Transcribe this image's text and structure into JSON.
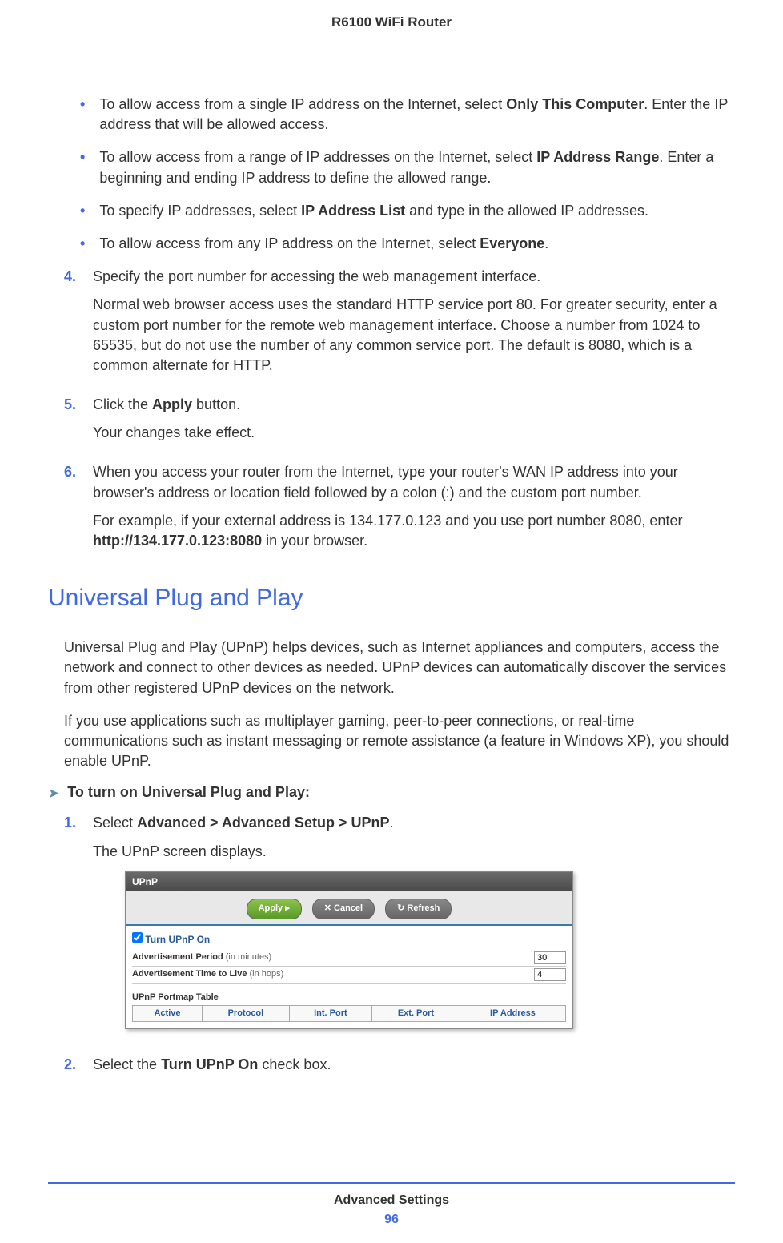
{
  "header_title": "R6100 WiFi Router",
  "sub_bullets": [
    {
      "pre": "To allow access from a single IP address on the Internet, select ",
      "bold": "Only This Computer",
      "post": ". Enter the IP address that will be allowed access."
    },
    {
      "pre": " To allow access from a range of IP addresses on the Internet, select ",
      "bold": "IP Address Range",
      "post": ". Enter a beginning and ending IP address to define the allowed range."
    },
    {
      "pre": " To specify IP addresses, select ",
      "bold": "IP Address List",
      "post": " and type in the allowed IP addresses."
    },
    {
      "pre": " To allow access from any IP address on the Internet, select ",
      "bold": "Everyone",
      "post": "."
    }
  ],
  "step4": {
    "num": "4.",
    "text": "Specify the port number for accessing the web management interface.",
    "para": "Normal web browser access uses the standard HTTP service port 80. For greater security, enter a custom port number for the remote web management interface. Choose a number from 1024 to 65535, but do not use the number of any common service port. The default is 8080, which is a common alternate for HTTP."
  },
  "step5": {
    "num": "5.",
    "pre": "Click the ",
    "bold": "Apply",
    "post": " button.",
    "para": "Your changes take effect."
  },
  "step6": {
    "num": "6.",
    "text": "When you access your router from the Internet, type your router's WAN IP address into your browser's address or location field followed by a colon (:) and the custom port number.",
    "para_pre": "For example, if your external address is 134.177.0.123 and you use port number 8080, enter ",
    "para_bold": "http://134.177.0.123:8080",
    "para_post": " in your browser."
  },
  "section_heading": "Universal Plug and Play",
  "upnp_para1": "Universal Plug and Play (UPnP) helps devices, such as Internet appliances and computers, access the network and connect to other devices as needed. UPnP devices can automatically discover the services from other registered UPnP devices on the network.",
  "upnp_para2": "If you use applications such as multiplayer gaming, peer-to-peer connections, or real-time communications such as instant messaging or remote assistance (a feature in Windows XP), you should enable UPnP.",
  "procedure_title": "To turn on Universal Plug and Play:",
  "proc_step1": {
    "num": "1.",
    "pre": "Select ",
    "bold": "Advanced > Advanced Setup > UPnP",
    "post": ".",
    "para": "The UPnP screen displays."
  },
  "proc_step2": {
    "num": "2.",
    "pre": "Select the ",
    "bold": "Turn UPnP On",
    "post": " check box."
  },
  "ui": {
    "title": "UPnP",
    "btn_apply": "Apply ▸",
    "btn_cancel": "✕ Cancel",
    "btn_refresh": "↻ Refresh",
    "checkbox_label": "Turn UPnP On",
    "adv_period_label": "Advertisement Period",
    "adv_period_sub": " (in minutes)",
    "adv_period_val": "30",
    "adv_ttl_label": "Advertisement Time to Live",
    "adv_ttl_sub": " (in hops)",
    "adv_ttl_val": "4",
    "portmap_title": "UPnP Portmap Table",
    "cols": [
      "Active",
      "Protocol",
      "Int. Port",
      "Ext. Port",
      "IP Address"
    ]
  },
  "footer_text": "Advanced Settings",
  "footer_page": "96"
}
